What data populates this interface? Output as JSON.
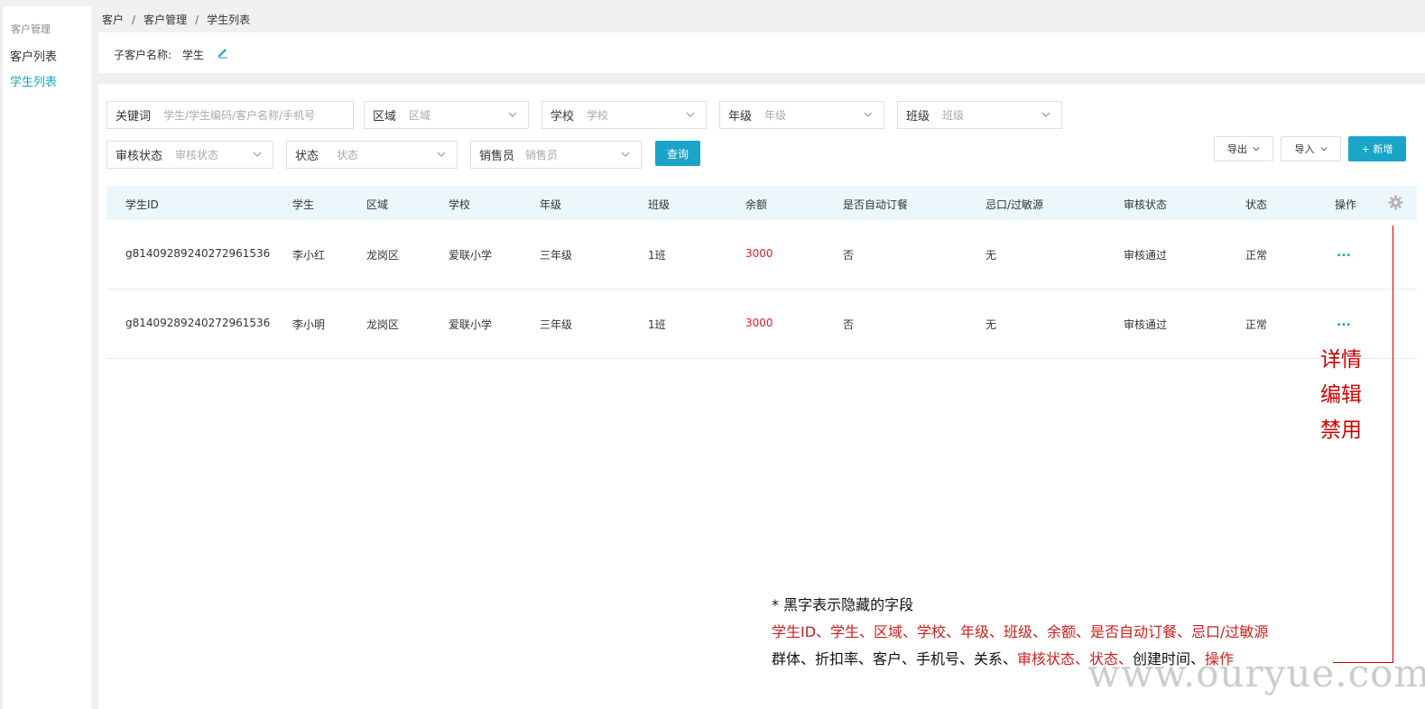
{
  "sidebar": {
    "section_title": "客户管理",
    "items": [
      {
        "label": "客户列表"
      },
      {
        "label": "学生列表"
      }
    ]
  },
  "breadcrumb": [
    "客户",
    "客户管理",
    "学生列表"
  ],
  "sub_customer": {
    "label": "子客户名称:",
    "value": "学生"
  },
  "filters": {
    "keyword": {
      "label": "关键词",
      "placeholder": "学生/学生编码/客户名称/手机号"
    },
    "region": {
      "label": "区域",
      "placeholder": "区域"
    },
    "school": {
      "label": "学校",
      "placeholder": "学校"
    },
    "grade": {
      "label": "年级",
      "placeholder": "年级"
    },
    "class": {
      "label": "班级",
      "placeholder": "班级"
    },
    "review_status": {
      "label": "审核状态",
      "placeholder": "审核状态"
    },
    "status": {
      "label": "状态",
      "placeholder": "状态"
    },
    "salesperson": {
      "label": "销售员",
      "placeholder": "销售员"
    }
  },
  "buttons": {
    "query": "查询",
    "export": "导出",
    "import": "导入",
    "add": "+ 新增"
  },
  "table": {
    "columns": [
      "学生ID",
      "学生",
      "区域",
      "学校",
      "年级",
      "班级",
      "余额",
      "是否自动订餐",
      "忌口/过敏源",
      "审核状态",
      "状态",
      "操作"
    ],
    "rows": [
      {
        "id": "g8140928924027296153​6",
        "name": "李小红",
        "region": "龙岗区",
        "school": "爱联小学",
        "grade": "三年级",
        "class": "1班",
        "balance": "3000",
        "auto_order": "否",
        "allergy": "无",
        "review": "审核通过",
        "status": "正常",
        "action": "..."
      },
      {
        "id": "g81409289240272961536",
        "name": "李小明",
        "region": "龙岗区",
        "school": "爱联小学",
        "grade": "三年级",
        "class": "1班",
        "balance": "3000",
        "auto_order": "否",
        "allergy": "无",
        "review": "审核通过",
        "status": "正常",
        "action": "..."
      }
    ]
  },
  "annotation": {
    "menu": [
      "详情",
      "编辑",
      "禁用"
    ],
    "note_title": "* 黑字表示隐藏的字段",
    "note_line2": "学生ID、学生、区域、学校、年级、班级、余额、是否自动订餐、忌口/过敏源",
    "note_line3_parts": [
      "群体、折扣率、客户、手机号、关系、",
      "审核状态、状态、",
      "创建时间、",
      "操作"
    ]
  },
  "watermark": "www.ouryue.com",
  "colors": {
    "accent": "#1aa5c8",
    "balance": "#e02020",
    "annotation": "#cc0000",
    "header_bg": "#ebf7fb"
  }
}
